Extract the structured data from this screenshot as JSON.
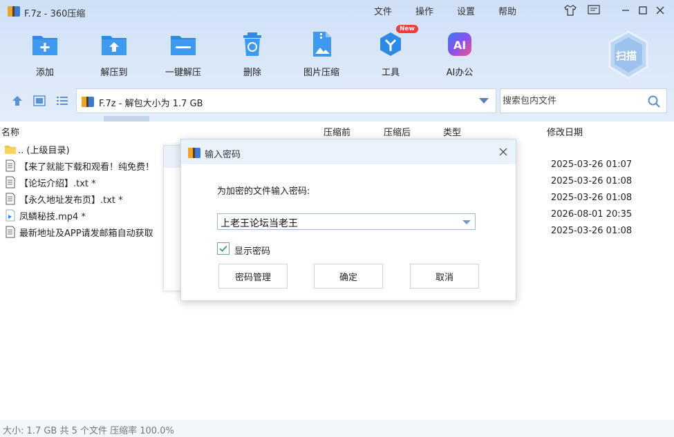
{
  "window": {
    "title": "F.7z - 360压缩",
    "menus": [
      "文件",
      "操作",
      "设置",
      "帮助"
    ]
  },
  "toolbar": {
    "items": [
      {
        "label": "添加",
        "icon": "add-folder-icon"
      },
      {
        "label": "解压到",
        "icon": "extract-to-icon"
      },
      {
        "label": "一键解压",
        "icon": "one-click-extract-icon"
      },
      {
        "label": "删除",
        "icon": "delete-bin-icon"
      },
      {
        "label": "图片压缩",
        "icon": "image-compress-icon"
      },
      {
        "label": "工具",
        "icon": "tools-icon",
        "badge": "New"
      },
      {
        "label": "AI办公",
        "icon": "ai-office-icon"
      }
    ],
    "scan_label": "扫描"
  },
  "address": {
    "text": "F.7z - 解包大小为 1.7 GB"
  },
  "search": {
    "placeholder": "搜索包内文件"
  },
  "columns": {
    "name": "名称",
    "packed": "压缩前",
    "unpacked": "压缩后",
    "type": "类型",
    "modified": "修改日期"
  },
  "files": [
    {
      "name": ".. (上级目录)",
      "date": "",
      "icon": "folder-icon"
    },
    {
      "name": "【来了就能下载和观看！纯免费！",
      "date": "2025-03-26 01:07",
      "icon": "text-file-icon"
    },
    {
      "name": "【论坛介绍】.txt *",
      "date": "2025-03-26 01:08",
      "icon": "text-file-icon"
    },
    {
      "name": "【永久地址发布页】.txt *",
      "date": "2025-03-26 01:08",
      "icon": "text-file-icon"
    },
    {
      "name": "凤鳞秘技.mp4 *",
      "date": "2026-08-01 20:35",
      "icon": "video-file-icon"
    },
    {
      "name": "最新地址及APP请发邮箱自动获取",
      "date": "2025-03-26 01:08",
      "icon": "text-file-icon"
    }
  ],
  "status": {
    "text": "大小: 1.7 GB 共 5 个文件 压缩率 100.0%"
  },
  "dialog": {
    "title": "输入密码",
    "prompt": "为加密的文件输入密码:",
    "password_value": "上老王论坛当老王",
    "show_password_label": "显示密码",
    "show_password_checked": true,
    "buttons": {
      "manage": "密码管理",
      "ok": "确定",
      "cancel": "取消"
    }
  },
  "colors": {
    "accent": "#2f8ae5",
    "topbar": "#d6e5f8",
    "badge": "#f23c3c"
  }
}
